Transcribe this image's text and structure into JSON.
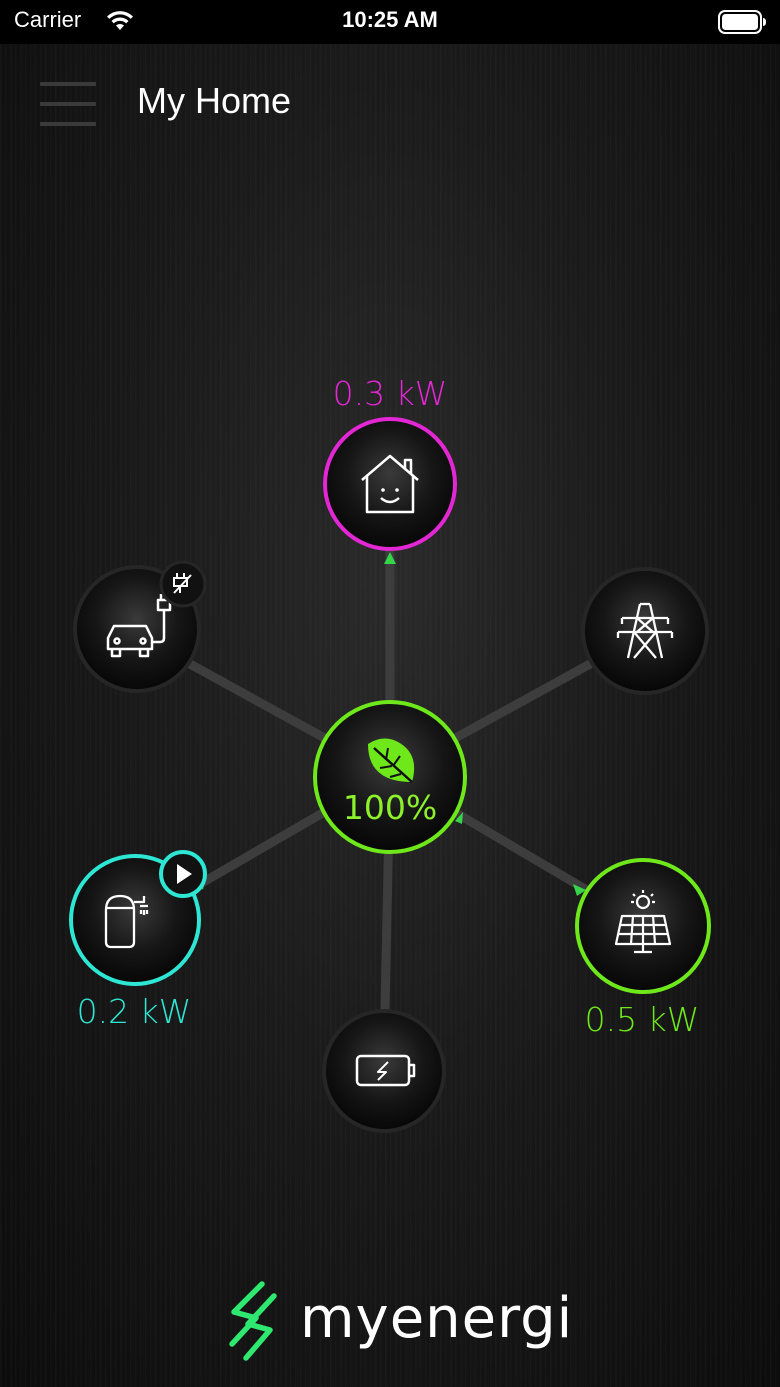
{
  "status_bar": {
    "carrier": "Carrier",
    "time": "10:25 AM"
  },
  "header": {
    "title": "My Home"
  },
  "flow": {
    "home": {
      "power": "0.3 kW",
      "color": "#e327d4"
    },
    "center": {
      "green_percent": "100%",
      "color": "#8cf02a"
    },
    "ev_charger": {
      "status": "unplugged"
    },
    "grid": {},
    "water_heater": {
      "power": "0.2 kW",
      "color": "#2ee6d4",
      "status": "boosting"
    },
    "solar": {
      "power": "0.5 kW",
      "color": "#6ee81b"
    },
    "battery": {}
  },
  "brand": {
    "name": "myenergi",
    "color": "#2ee870"
  },
  "icons": {
    "menu": "hamburger-menu-icon",
    "home": "smiling-house-icon",
    "center": "leaf-icon",
    "ev": "car-charger-icon",
    "grid": "pylon-icon",
    "water": "water-heater-icon",
    "solar": "solar-panel-icon",
    "battery": "battery-icon"
  }
}
